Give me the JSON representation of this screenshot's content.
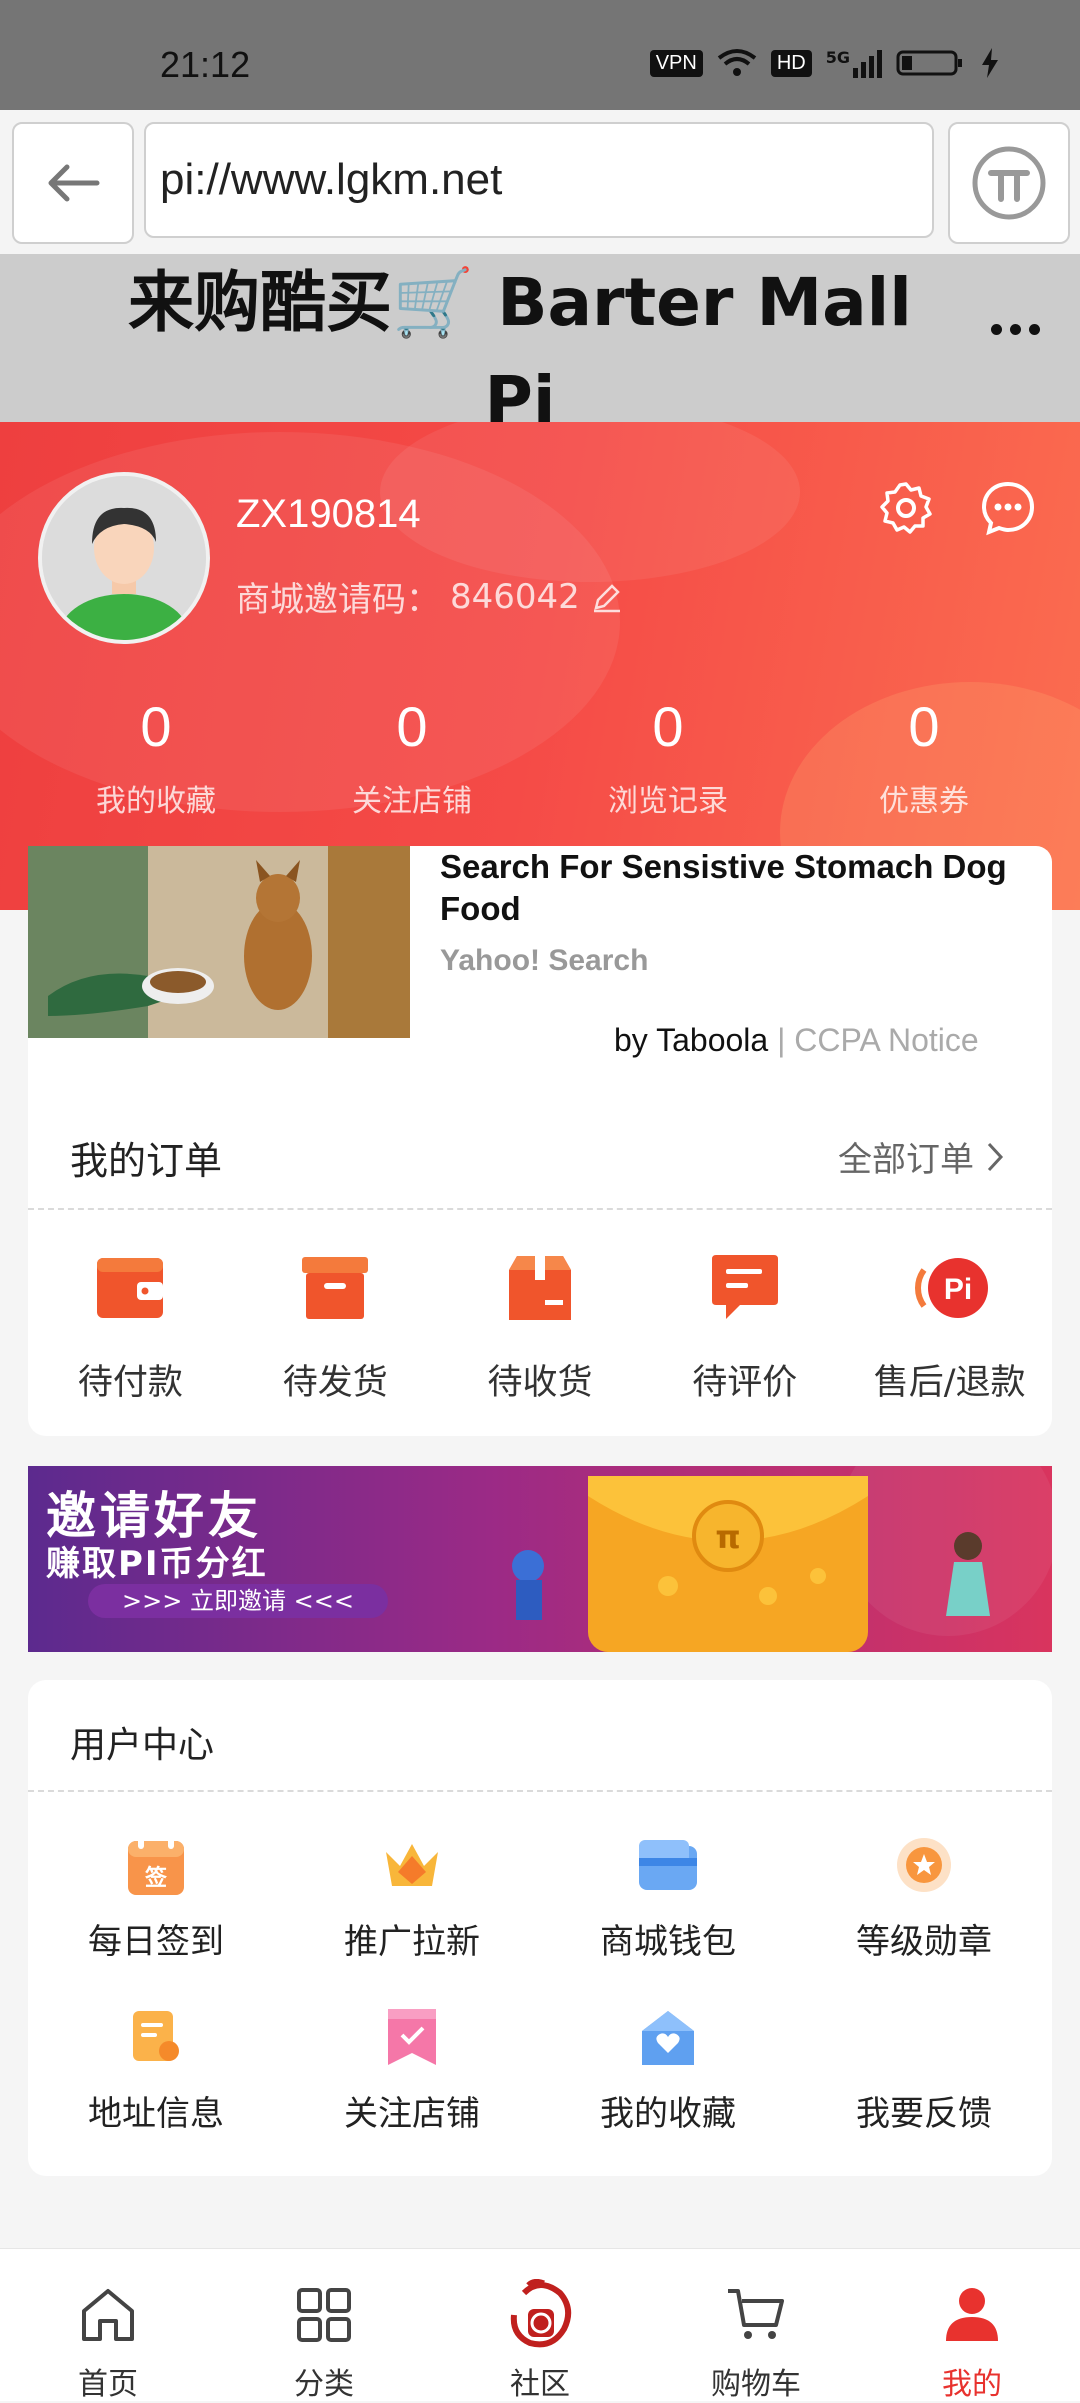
{
  "status_bar": {
    "time": "21:12",
    "vpn": "VPN",
    "hd": "HD",
    "network": "5G"
  },
  "browser": {
    "url": "pi://www.lgkm.net"
  },
  "page_title": {
    "line1": "来购酷买🛒 Barter Mall",
    "line2": "Pi"
  },
  "profile": {
    "username": "ZX190814",
    "invite_label": "商城邀请码：",
    "invite_code": "846042"
  },
  "stats": [
    {
      "value": "0",
      "label": "我的收藏"
    },
    {
      "value": "0",
      "label": "关注店铺"
    },
    {
      "value": "0",
      "label": "浏览记录"
    },
    {
      "value": "0",
      "label": "优惠券"
    }
  ],
  "ad": {
    "title": "Search For Sensistive Stomach Dog Food",
    "source": "Yahoo! Search",
    "by": "by Taboola",
    "notice": "| CCPA Notice"
  },
  "orders": {
    "title": "我的订单",
    "all_label": "全部订单",
    "items": [
      {
        "label": "待付款",
        "icon": "wallet-icon"
      },
      {
        "label": "待发货",
        "icon": "box-icon"
      },
      {
        "label": "待收货",
        "icon": "package-icon"
      },
      {
        "label": "待评价",
        "icon": "comment-icon"
      },
      {
        "label": "售后/退款",
        "icon": "pi-refund-icon"
      }
    ]
  },
  "banner": {
    "line1": "邀请好友",
    "line2": "赚取PI币分红",
    "cta": ">>> 立即邀请 <<<"
  },
  "user_center": {
    "title": "用户中心",
    "items": [
      {
        "label": "每日签到",
        "icon": "calendar-checkin-icon"
      },
      {
        "label": "推广拉新",
        "icon": "crown-icon"
      },
      {
        "label": "商城钱包",
        "icon": "wallet-card-icon"
      },
      {
        "label": "等级勋章",
        "icon": "medal-icon"
      },
      {
        "label": "地址信息",
        "icon": "address-note-icon"
      },
      {
        "label": "关注店铺",
        "icon": "shop-follow-icon"
      },
      {
        "label": "我的收藏",
        "icon": "favorite-house-icon"
      },
      {
        "label": "我要反馈",
        "icon": "feedback-icon"
      }
    ]
  },
  "nav": [
    {
      "label": "首页",
      "icon": "home-icon"
    },
    {
      "label": "分类",
      "icon": "category-grid-icon"
    },
    {
      "label": "社区",
      "icon": "community-logo-icon"
    },
    {
      "label": "购物车",
      "icon": "cart-icon"
    },
    {
      "label": "我的",
      "icon": "user-icon",
      "active": true
    }
  ],
  "colors": {
    "brand_red": "#e8322e",
    "orange": "#f5582a"
  }
}
